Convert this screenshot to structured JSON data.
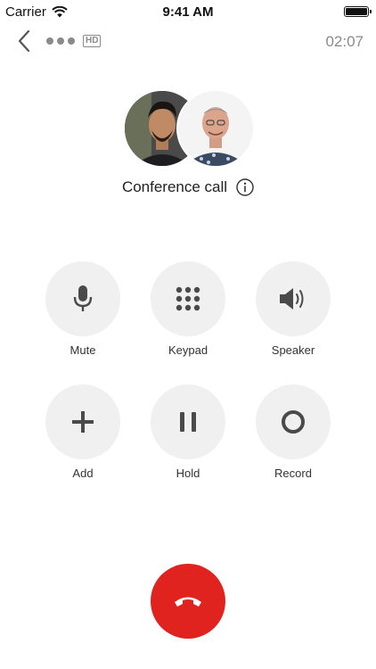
{
  "status_bar": {
    "carrier": "Carrier",
    "time": "9:41 AM",
    "wifi_icon": "wifi-icon",
    "battery_icon": "battery-icon"
  },
  "call_bar": {
    "back_icon": "chevron-left-icon",
    "signal_icon": "signal-dots-icon",
    "hd_label": "HD",
    "duration": "02:07"
  },
  "call": {
    "title": "Conference call",
    "info_icon": "info-icon"
  },
  "controls": [
    {
      "label": "Mute",
      "icon": "microphone-icon"
    },
    {
      "label": "Keypad",
      "icon": "keypad-icon"
    },
    {
      "label": "Speaker",
      "icon": "speaker-icon"
    },
    {
      "label": "Add",
      "icon": "plus-icon"
    },
    {
      "label": "Hold",
      "icon": "pause-icon"
    },
    {
      "label": "Record",
      "icon": "record-icon"
    }
  ],
  "end_call": {
    "icon": "hang-up-icon"
  },
  "colors": {
    "end_call": "#e0231e",
    "control_bg": "#f0f0f0",
    "icon": "#4a4a4a",
    "muted_text": "#8a8a8a"
  }
}
